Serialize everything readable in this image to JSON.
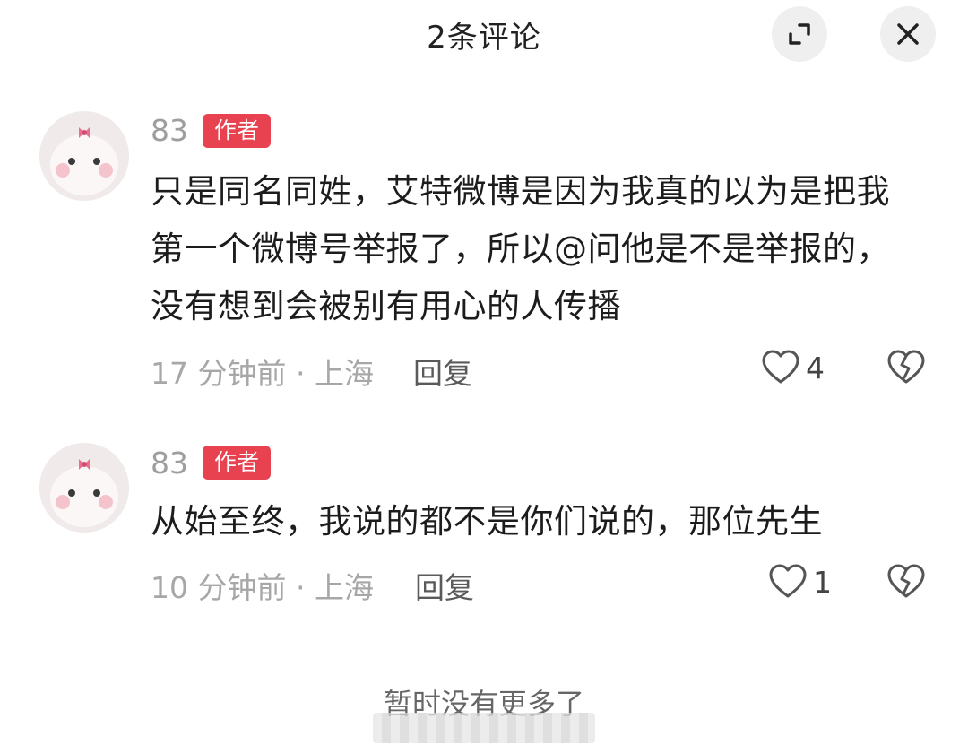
{
  "header": {
    "title": "2条评论"
  },
  "comments": [
    {
      "username": "83",
      "badge": "作者",
      "text": "只是同名同姓，艾特微博是因为我真的以为是把我第一个微博号举报了，所以@问他是不是举报的，没有想到会被别有用心的人传播",
      "time": "17 分钟前 · 上海",
      "reply_label": "回复",
      "likes": "4"
    },
    {
      "username": "83",
      "badge": "作者",
      "text": "从始至终，我说的都不是你们说的，那位先生",
      "time": "10 分钟前 · 上海",
      "reply_label": "回复",
      "likes": "1"
    }
  ],
  "footer": {
    "note": "暂时没有更多了"
  }
}
